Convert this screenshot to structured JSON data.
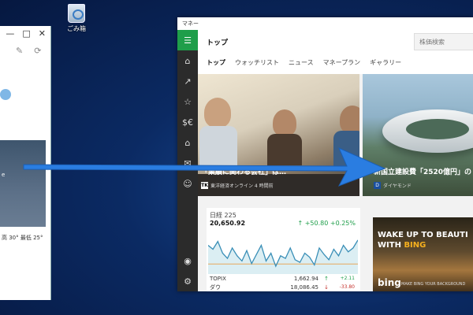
{
  "desktop": {
    "recycle_bin_label": "ごみ箱"
  },
  "left_window": {
    "controls": [
      "—",
      "□",
      "✕"
    ],
    "hero_text": "e",
    "temps": "高 30° 最低 25°"
  },
  "app": {
    "window_title": "マネー",
    "page_title": "トップ",
    "search_placeholder": "株価検索",
    "tabs": [
      "トップ",
      "ウォッチリスト",
      "ニュース",
      "マネープラン",
      "ギャラリー"
    ],
    "hero1": {
      "caption": "「業績に関わる会社」は…",
      "source": "東洋経済オンライン  4 時間前",
      "source_logo": "TK"
    },
    "hero2": {
      "caption": "新国立建設費「2520億円」の",
      "source": "ダイヤモンド",
      "source_logo": "D"
    },
    "market": {
      "name": "日経 225",
      "value": "20,650.92",
      "change": "↑ +50.80  +0.25%"
    },
    "indices": [
      {
        "name": "TOPIX",
        "value": "1,662.94",
        "dir": "up",
        "arrow": "↑",
        "change": "+2.11"
      },
      {
        "name": "ダウ",
        "value": "18,086.45",
        "dir": "down",
        "arrow": "↓",
        "change": "-33.80"
      }
    ],
    "ad": {
      "line1": "WAKE UP TO BEAUTI",
      "line2_prefix": "WITH ",
      "line2_brand": "BING",
      "logo": "bing",
      "small": "MAKE BING YOUR BACKGROUND"
    }
  },
  "colors": {
    "accent_green": "#1f9e4a",
    "rail_bg": "#2b2b2b",
    "arrow_blue": "#2a7de1"
  },
  "chart_data": {
    "type": "line",
    "series": [
      {
        "values": [
          0.52,
          0.49,
          0.55,
          0.46,
          0.42,
          0.5,
          0.44,
          0.4,
          0.48,
          0.38,
          0.45,
          0.52,
          0.4,
          0.46,
          0.36,
          0.44,
          0.42,
          0.5,
          0.41,
          0.39,
          0.46,
          0.43,
          0.37,
          0.5,
          0.45,
          0.41,
          0.49,
          0.44,
          0.52,
          0.47,
          0.5,
          0.56
        ]
      }
    ],
    "ylim": [
      0.3,
      0.65
    ]
  }
}
